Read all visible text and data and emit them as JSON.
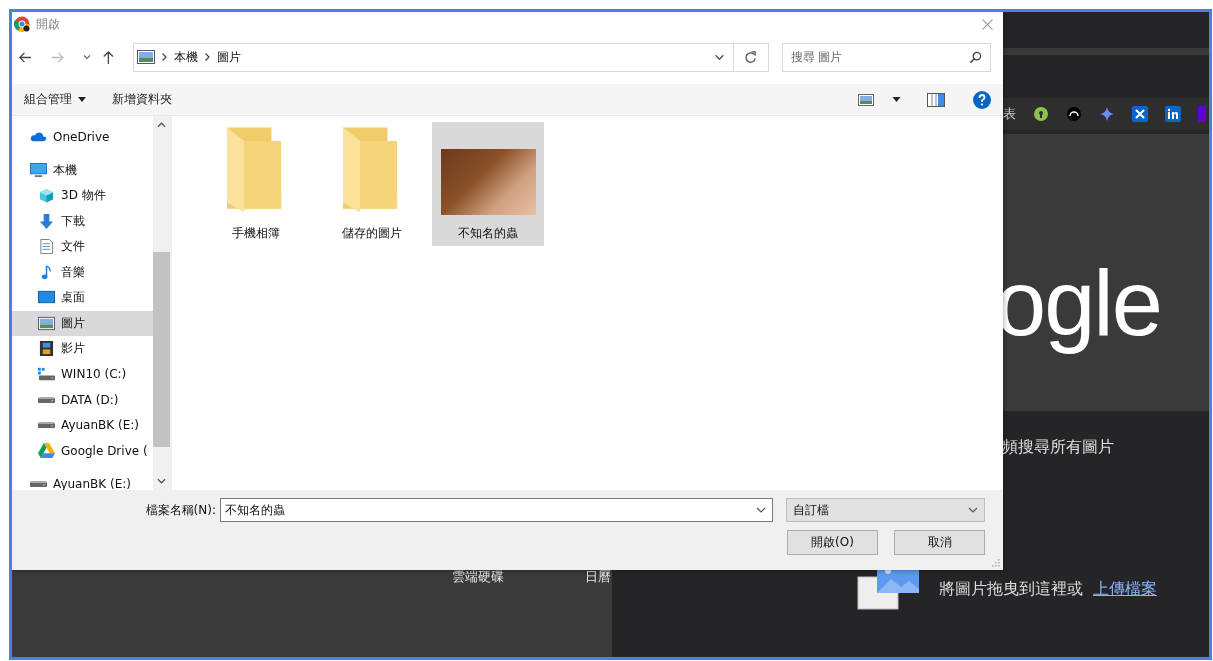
{
  "background": {
    "bookmark_text": "表",
    "logo_text": "ogle",
    "search_hint": "頻搜尋所有圖片",
    "tabs": [
      "雲端硬碟",
      "日曆"
    ],
    "drop_text": "將圖片拖曳到這裡或",
    "upload_link": "上傳檔案"
  },
  "dialog": {
    "title": "開啟",
    "breadcrumb": [
      "本機",
      "圖片"
    ],
    "search": {
      "placeholder": "搜尋 圖片"
    },
    "toolbar": {
      "organize": "組合管理",
      "new_folder": "新增資料夾"
    },
    "sidebar": [
      {
        "label": "OneDrive",
        "kind": "cloud",
        "selected": false
      },
      {
        "label": "本機",
        "kind": "computer",
        "selected": false,
        "children": [
          {
            "label": "3D 物件",
            "kind": "cube",
            "selected": false
          },
          {
            "label": "下載",
            "kind": "download",
            "selected": false
          },
          {
            "label": "文件",
            "kind": "document",
            "selected": false
          },
          {
            "label": "音樂",
            "kind": "music",
            "selected": false
          },
          {
            "label": "桌面",
            "kind": "desktop",
            "selected": false
          },
          {
            "label": "圖片",
            "kind": "picture",
            "selected": true
          },
          {
            "label": "影片",
            "kind": "film",
            "selected": false
          },
          {
            "label": "WIN10 (C:)",
            "kind": "systemdrive",
            "selected": false
          },
          {
            "label": "DATA (D:)",
            "kind": "drive",
            "selected": false
          },
          {
            "label": "AyuanBK (E:)",
            "kind": "drive",
            "selected": false
          },
          {
            "label": "Google Drive (",
            "kind": "gdrive",
            "selected": false
          }
        ]
      },
      {
        "label": "AyuanBK (E:)",
        "kind": "drive",
        "selected": false
      }
    ],
    "files": [
      {
        "name": "手機相簿",
        "kind": "folder",
        "selected": false
      },
      {
        "name": "儲存的圖片",
        "kind": "folder",
        "selected": false
      },
      {
        "name": "不知名的蟲",
        "kind": "image",
        "selected": true
      }
    ],
    "filename_label": "檔案名稱(N):",
    "filename": "不知名的蟲",
    "filter": "自訂檔",
    "buttons": [
      "開啟(O)",
      "取消"
    ]
  }
}
